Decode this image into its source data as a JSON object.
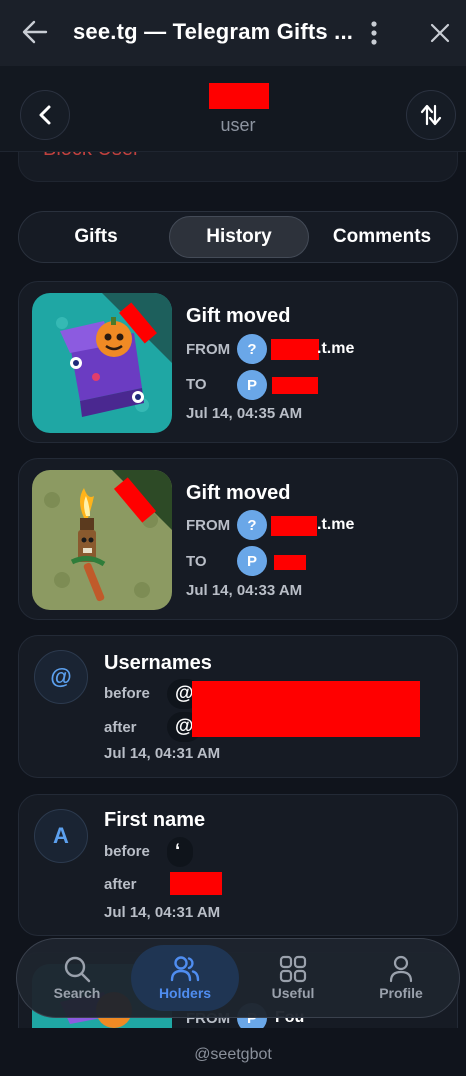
{
  "appbar": {
    "title": "see.tg — Telegram Gifts ..."
  },
  "header": {
    "subtitle": "user"
  },
  "block_card": {
    "label": "Block User"
  },
  "tabs": [
    {
      "label": "Gifts",
      "active": false
    },
    {
      "label": "History",
      "active": true
    },
    {
      "label": "Comments",
      "active": false
    }
  ],
  "history": [
    {
      "title": "Gift moved",
      "from_label": "FROM",
      "from_avatar": "?",
      "from_suffix": ".t.me",
      "to_label": "TO",
      "to_avatar": "P",
      "date": "Jul 14, 04:35 AM",
      "thumb": "jack-in-the-box-gift"
    },
    {
      "title": "Gift moved",
      "from_label": "FROM",
      "from_avatar": "?",
      "from_suffix": ".t.me",
      "to_label": "TO",
      "to_avatar": "P",
      "date": "Jul 14, 04:33 AM",
      "thumb": "tiki-torch-gift"
    },
    {
      "title": "Usernames",
      "avatar": "@",
      "before_label": "before",
      "before_value": "@",
      "after_label": "after",
      "after_value": "@",
      "date": "Jul 14, 04:31 AM"
    },
    {
      "title": "First name",
      "avatar": "A",
      "before_label": "before",
      "before_value": "‘",
      "after_label": "after",
      "date": "Jul 14, 04:31 AM"
    },
    {
      "from_label": "FROM",
      "from_avatar": "P",
      "from_partial": "Fou"
    }
  ],
  "nav": [
    {
      "label": "Search",
      "icon": "search-icon",
      "active": false
    },
    {
      "label": "Holders",
      "icon": "users-icon",
      "active": true
    },
    {
      "label": "Useful",
      "icon": "grid-icon",
      "active": false
    },
    {
      "label": "Profile",
      "icon": "person-icon",
      "active": false
    }
  ],
  "footer": {
    "handle": "@seetgbot"
  },
  "colors": {
    "accent": "#4f8df0",
    "pill": "#6aa7e8",
    "redaction": "#ff0000",
    "background": "#10141c",
    "card": "#161b24"
  }
}
